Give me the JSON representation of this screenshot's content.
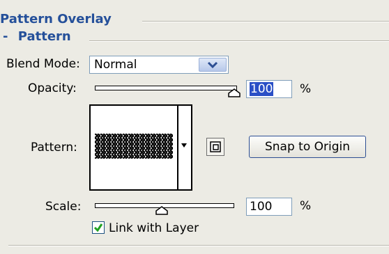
{
  "panel": {
    "title": "Pattern Overlay",
    "subsection_prefix": "-",
    "subsection": "Pattern"
  },
  "blend_mode": {
    "label": "Blend Mode:",
    "value": "Normal"
  },
  "opacity": {
    "label": "Opacity:",
    "value": "100",
    "unit": "%",
    "slider_fraction": 1.0
  },
  "pattern": {
    "label": "Pattern:",
    "snap_label": "Snap to Origin"
  },
  "scale": {
    "label": "Scale:",
    "value": "100",
    "unit": "%",
    "slider_fraction": 0.48
  },
  "link": {
    "label": "Link with Layer",
    "checked": true
  },
  "colors": {
    "heading": "#25509a",
    "background": "#ecebe4",
    "check": "#21a121",
    "selection": "#2a4fc6"
  },
  "icons": [
    "chevron-down-icon",
    "pattern-menu-arrow-icon",
    "new-preset-icon",
    "checkmark-icon",
    "slider-thumb-icon"
  ]
}
